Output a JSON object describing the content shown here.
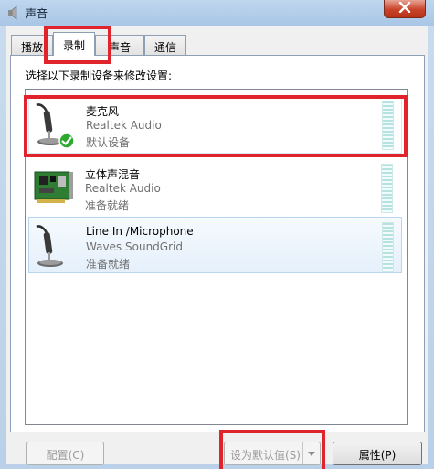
{
  "window": {
    "title": "声音"
  },
  "tabs": [
    {
      "label": "播放"
    },
    {
      "label": "录制"
    },
    {
      "label": "声音"
    },
    {
      "label": "通信"
    }
  ],
  "recording": {
    "instruction": "选择以下录制设备来修改设置:",
    "devices": [
      {
        "name": "麦克风",
        "driver": "Realtek Audio",
        "status": "默认设备",
        "icon": "microphone-icon",
        "is_default": true
      },
      {
        "name": "立体声混音",
        "driver": "Realtek Audio",
        "status": "准备就绪",
        "icon": "sound-card-icon",
        "is_default": false
      },
      {
        "name": "Line In /Microphone",
        "driver": "Waves SoundGrid",
        "status": "准备就绪",
        "icon": "microphone-icon",
        "is_default": false
      }
    ]
  },
  "buttons": {
    "configure": "配置(C)",
    "set_default": "设为默认值(S)",
    "properties": "属性(P)"
  },
  "colors": {
    "highlight": "#e0242b",
    "default_check": "#2ea82e",
    "level_meter": "#b6e3e2"
  }
}
